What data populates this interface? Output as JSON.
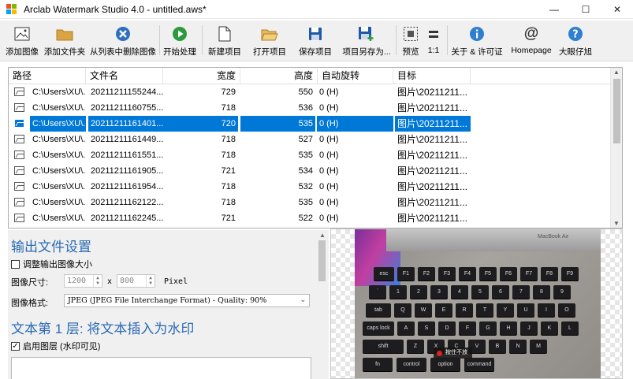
{
  "window": {
    "title": "Arclab Watermark Studio 4.0 - untitled.aws*",
    "minimize": "—",
    "maximize": "☐",
    "close": "✕"
  },
  "toolbar": {
    "add_image": "添加图像",
    "add_folder": "添加文件夹",
    "remove_from_list": "从列表中删除图像",
    "start": "开始处理",
    "new_project": "新建项目",
    "open_project": "打开项目",
    "save_project": "保存项目",
    "save_project_as": "项目另存为...",
    "preview": "预览",
    "one_to_one": "1:1",
    "about": "关于 & 许可证",
    "homepage": "Homepage",
    "help": "大眼仔旭"
  },
  "table": {
    "columns": [
      "路径",
      "文件名",
      "宽度",
      "高度",
      "自动旋转",
      "目标"
    ],
    "rows": [
      {
        "path": "C:\\Users\\XU\\...",
        "name": "20211211155244...",
        "width": "729",
        "height": "550",
        "rotate": "0 (H)",
        "target": "图片\\20211211..."
      },
      {
        "path": "C:\\Users\\XU\\...",
        "name": "20211211160755...",
        "width": "718",
        "height": "536",
        "rotate": "0 (H)",
        "target": "图片\\20211211..."
      },
      {
        "path": "C:\\Users\\XU\\...",
        "name": "20211211161401...",
        "width": "720",
        "height": "535",
        "rotate": "0 (H)",
        "target": "图片\\20211211..."
      },
      {
        "path": "C:\\Users\\XU\\...",
        "name": "20211211161449...",
        "width": "718",
        "height": "527",
        "rotate": "0 (H)",
        "target": "图片\\20211211..."
      },
      {
        "path": "C:\\Users\\XU\\...",
        "name": "20211211161551...",
        "width": "718",
        "height": "535",
        "rotate": "0 (H)",
        "target": "图片\\20211211..."
      },
      {
        "path": "C:\\Users\\XU\\...",
        "name": "20211211161905...",
        "width": "721",
        "height": "534",
        "rotate": "0 (H)",
        "target": "图片\\20211211..."
      },
      {
        "path": "C:\\Users\\XU\\...",
        "name": "20211211161954...",
        "width": "718",
        "height": "532",
        "rotate": "0 (H)",
        "target": "图片\\20211211..."
      },
      {
        "path": "C:\\Users\\XU\\...",
        "name": "20211211162122...",
        "width": "718",
        "height": "535",
        "rotate": "0 (H)",
        "target": "图片\\20211211..."
      },
      {
        "path": "C:\\Users\\XU\\...",
        "name": "20211211162245...",
        "width": "721",
        "height": "522",
        "rotate": "0 (H)",
        "target": "图片\\20211211..."
      }
    ],
    "selected_row": 2
  },
  "settings": {
    "output_title": "输出文件设置",
    "resize_label": "调整输出图像大小",
    "resize_checked": false,
    "size_label": "图像尺寸:",
    "width_value": "1200",
    "times": "x",
    "height_value": "800",
    "unit": "Pixel",
    "format_label": "图像格式:",
    "format_value": "JPEG (JPEG File Interchange Format) - Quality: 90%",
    "layer_title": "文本第 1 层: 将文本插入为水印",
    "enable_layer_label": "启用图层 (水印可见)",
    "enable_layer_checked": true
  },
  "preview": {
    "laptop_label": "MacBook Air",
    "toast_text": "按住不放",
    "keys": [
      "esc",
      "F1",
      "F2",
      "F3",
      "F4",
      "F5",
      "F6",
      "F7",
      "F8",
      "F9",
      "`",
      "1",
      "2",
      "3",
      "4",
      "5",
      "6",
      "7",
      "8",
      "9",
      "tab",
      "Q",
      "W",
      "E",
      "R",
      "T",
      "Y",
      "U",
      "I",
      "O",
      "caps lock",
      "A",
      "S",
      "D",
      "F",
      "G",
      "H",
      "J",
      "K",
      "L",
      "shift",
      "Z",
      "X",
      "C",
      "V",
      "B",
      "N",
      "M",
      "fn",
      "control",
      "option",
      "command"
    ]
  },
  "colors": {
    "selection": "#0078d7",
    "section_title": "#2a6ab3",
    "toolbar_bg": "#f0f0f0"
  }
}
